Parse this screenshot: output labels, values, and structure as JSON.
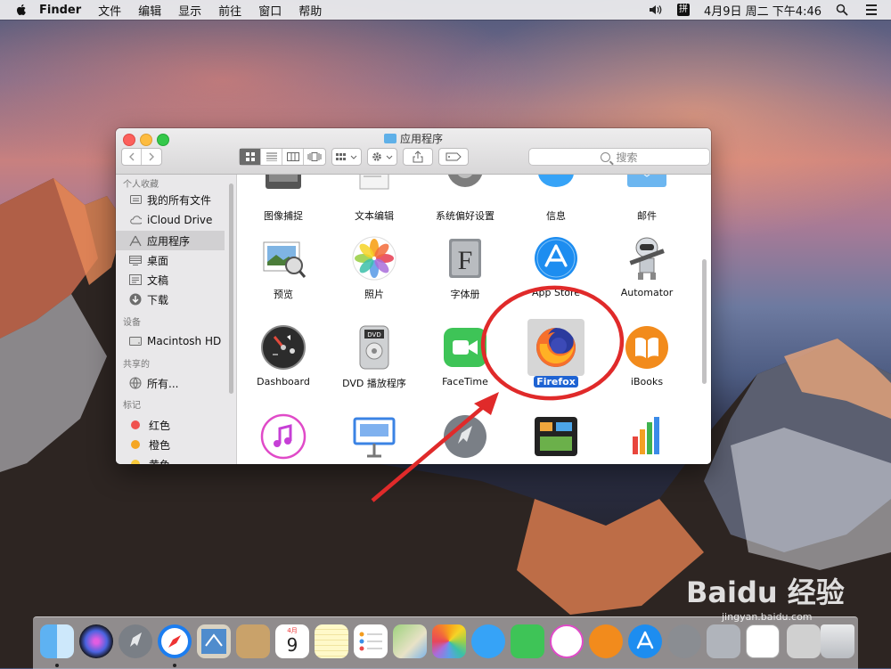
{
  "menubar": {
    "app_name": "Finder",
    "menus": [
      "文件",
      "编辑",
      "显示",
      "前往",
      "窗口",
      "帮助"
    ],
    "ime_label": "拼",
    "datetime": "4月9日 周二 下午4:46"
  },
  "window": {
    "title": "应用程序",
    "search_placeholder": "搜索"
  },
  "sidebar": {
    "favorites_header": "个人收藏",
    "favorites": [
      {
        "label": "我的所有文件",
        "icon": "all-files-icon"
      },
      {
        "label": "iCloud Drive",
        "icon": "cloud-icon"
      },
      {
        "label": "应用程序",
        "icon": "applications-icon",
        "selected": true
      },
      {
        "label": "桌面",
        "icon": "desktop-icon"
      },
      {
        "label": "文稿",
        "icon": "documents-icon"
      },
      {
        "label": "下载",
        "icon": "download-icon"
      }
    ],
    "devices_header": "设备",
    "devices": [
      {
        "label": "Macintosh HD",
        "icon": "disk-icon"
      }
    ],
    "shared_header": "共享的",
    "shared": [
      {
        "label": "所有...",
        "icon": "network-icon"
      }
    ],
    "tags_header": "标记",
    "tags": [
      {
        "label": "红色",
        "color": "#f0524f"
      },
      {
        "label": "橙色",
        "color": "#f5a623"
      },
      {
        "label": "黄色",
        "color": "#f7c93b"
      }
    ]
  },
  "apps": {
    "row1": [
      "图像捕捉",
      "文本编辑",
      "系统偏好设置",
      "信息",
      "邮件"
    ],
    "row2": [
      "预览",
      "照片",
      "字体册",
      "App Store",
      "Automator"
    ],
    "row3": [
      "Dashboard",
      "DVD 播放程序",
      "FaceTime",
      "Firefox",
      "iBooks"
    ],
    "row4_icons": [
      "itunes-icon",
      "keynote-icon",
      "launchpad-icon",
      "mission-control-icon",
      "numbers-icon"
    ],
    "selected": "Firefox"
  },
  "colors": {
    "selection": "#1e63d3",
    "annotation": "#e02a2a"
  },
  "dock": {
    "icons": [
      "finder-icon",
      "siri-icon",
      "launchpad-icon",
      "safari-icon",
      "mail-icon",
      "contacts-icon",
      "calendar-icon",
      "notes-icon",
      "reminders-icon",
      "maps-icon",
      "photos-icon",
      "messages-icon",
      "facetime-icon",
      "itunes-icon",
      "ibooks-icon",
      "app-store-icon",
      "system-preferences-icon",
      "preview-icon",
      "firefox-icon",
      "downloads-icon",
      "trash-icon"
    ],
    "calendar_month": "4月",
    "calendar_day": "9"
  }
}
